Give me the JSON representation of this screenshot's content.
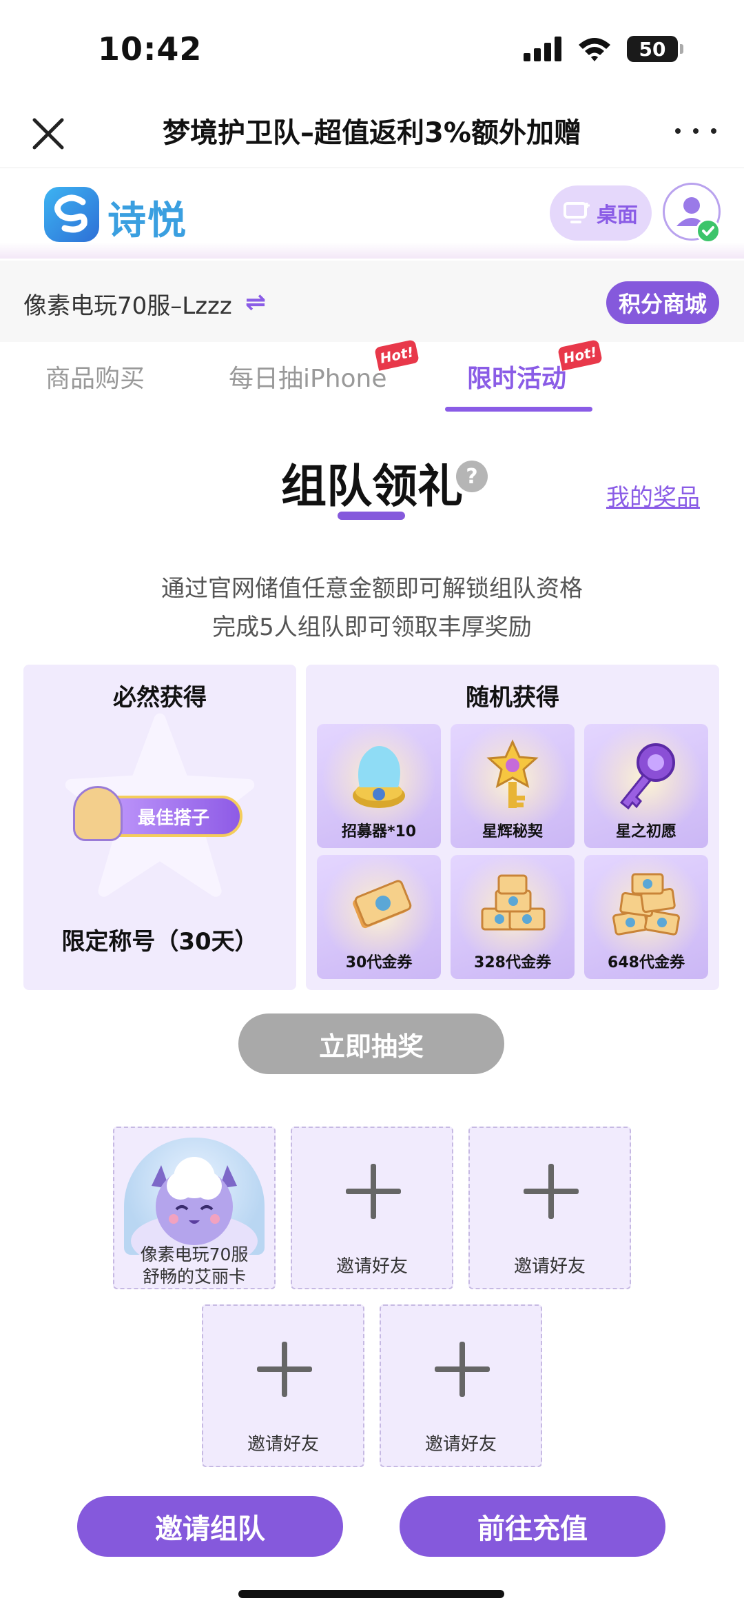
{
  "status_bar": {
    "time": "10:42",
    "battery": "50"
  },
  "titlebar": {
    "title": "梦境护卫队–超值返利3%额外加赠"
  },
  "site_header": {
    "logo_text": "诗悦",
    "desktop_label": "桌面"
  },
  "server_bar": {
    "server_name": "像素电玩70服–Lzzz",
    "points_mall_label": "积分商城"
  },
  "tabs": [
    {
      "label": "商品购买",
      "active": false,
      "hot": false
    },
    {
      "label": "每日抽iPhone",
      "active": false,
      "hot": true
    },
    {
      "label": "限时活动",
      "active": true,
      "hot": true
    }
  ],
  "hot_badge": "Hot!",
  "section": {
    "title": "组队领礼",
    "help": "?",
    "my_prizes_label": "我的奖品",
    "desc_line1": "通过官网储值任意金额即可解锁组队资格",
    "desc_line2": "完成5人组队即可领取丰厚奖励"
  },
  "fixed_reward": {
    "heading": "必然获得",
    "badge_text": "最佳搭子",
    "label": "限定称号（30天）"
  },
  "random_reward": {
    "heading": "随机获得",
    "items": [
      {
        "name": "招募器*10",
        "icon": "recruiter-icon"
      },
      {
        "name": "星辉秘契",
        "icon": "star-key-icon"
      },
      {
        "name": "星之初愿",
        "icon": "purple-key-icon"
      },
      {
        "name": "30代金券",
        "icon": "voucher-icon"
      },
      {
        "name": "328代金券",
        "icon": "voucher-stack-icon"
      },
      {
        "name": "648代金券",
        "icon": "voucher-pile-icon"
      }
    ]
  },
  "draw_button": "立即抽奖",
  "team": {
    "member": {
      "line1": "像素电玩70服",
      "line2": "舒畅的艾丽卡"
    },
    "invite_label": "邀请好友"
  },
  "bottom": {
    "invite_team": "邀请组队",
    "go_recharge": "前往充值"
  },
  "colors": {
    "accent": "#8559dc",
    "panel": "#f1ebfd",
    "hot": "#e8384a",
    "disabled": "#a9a9a9"
  }
}
